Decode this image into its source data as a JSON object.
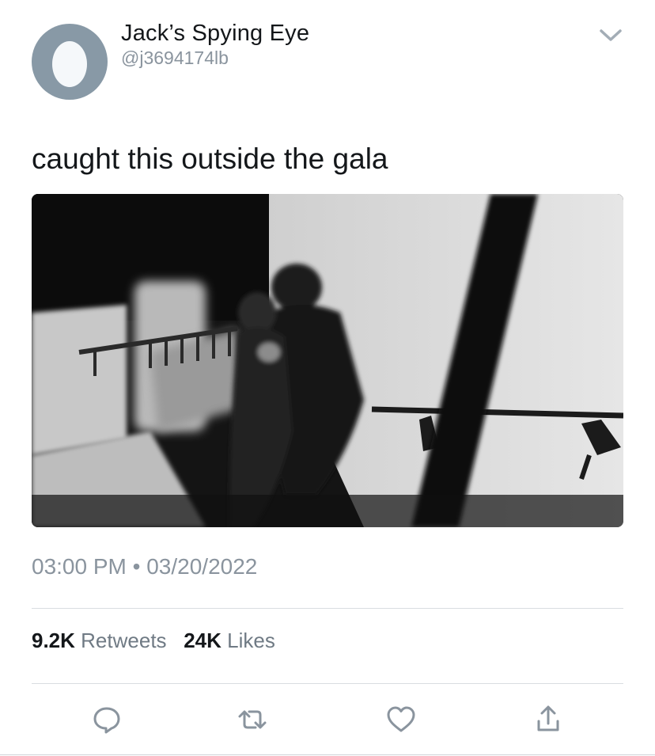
{
  "tweet": {
    "display_name": "Jack’s Spying Eye",
    "handle": "@j3694174lb",
    "text": "caught this outside the gala",
    "time": "03:00 PM",
    "separator": "•",
    "date": "03/20/2022"
  },
  "stats": {
    "retweets_count": "9.2K",
    "retweets_label": "Retweets",
    "likes_count": "24K",
    "likes_label": "Likes"
  },
  "icons": {
    "avatar": "default-egg-avatar",
    "menu": "chevron-down-icon",
    "reply": "reply-icon",
    "retweet": "retweet-icon",
    "like": "heart-icon",
    "share": "share-icon"
  },
  "colors": {
    "text": "#14171a",
    "secondary_text": "#8a949e",
    "avatar_bg": "#8899a6",
    "divider": "#d9dde1"
  }
}
